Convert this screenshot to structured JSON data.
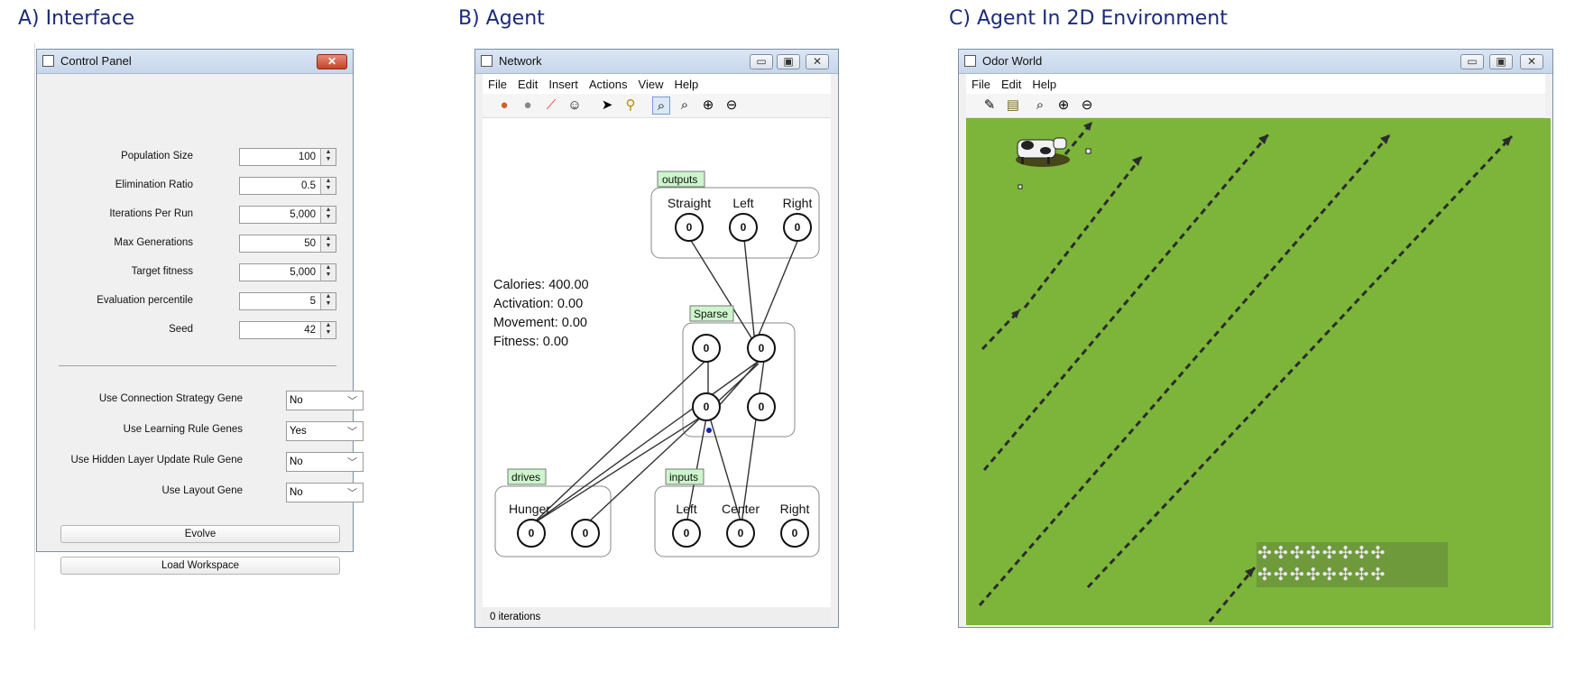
{
  "panels": {
    "a_title": "A) Interface",
    "b_title": "B) Agent",
    "c_title": "C) Agent In 2D Environment"
  },
  "control_panel": {
    "window_title": "Control Panel",
    "close_glyph": "✕",
    "fields": [
      {
        "label": "Population Size",
        "value": "100"
      },
      {
        "label": "Elimination Ratio",
        "value": "0.5"
      },
      {
        "label": "Iterations Per Run",
        "value": "5,000"
      },
      {
        "label": "Max Generations",
        "value": "50"
      },
      {
        "label": "Target fitness",
        "value": "5,000"
      },
      {
        "label": "Evaluation percentile",
        "value": "5"
      },
      {
        "label": "Seed",
        "value": "42"
      }
    ],
    "dropdowns": [
      {
        "label": "Use Connection Strategy Gene",
        "value": "No"
      },
      {
        "label": "Use Learning Rule Genes",
        "value": "Yes"
      },
      {
        "label": "Use Hidden Layer Update Rule Gene",
        "value": "No"
      },
      {
        "label": "Use Layout Gene",
        "value": "No"
      }
    ],
    "buttons": {
      "evolve": "Evolve",
      "load_workspace": "Load Workspace"
    }
  },
  "network": {
    "window_title": "Network",
    "menu": [
      "File",
      "Edit",
      "Insert",
      "Actions",
      "View",
      "Help"
    ],
    "toolbar_icons": [
      "neuron-icon",
      "gray-neuron-icon",
      "eraser-icon",
      "smiley-icon",
      "pointer-icon",
      "wand-icon",
      "zoom-fit-icon",
      "zoom-icon",
      "zoom-in-icon",
      "zoom-out-icon"
    ],
    "stats": [
      "Calories: 400.00",
      "Activation: 0.00",
      "Movement: 0.00",
      "Fitness: 0.00"
    ],
    "groups": {
      "outputs": {
        "label": "outputs",
        "neurons": [
          {
            "name": "Straight",
            "value": "0"
          },
          {
            "name": "Left",
            "value": "0"
          },
          {
            "name": "Right",
            "value": "0"
          }
        ]
      },
      "sparse": {
        "label": "Sparse",
        "neurons": [
          {
            "value": "0"
          },
          {
            "value": "0"
          },
          {
            "value": "0"
          },
          {
            "value": "0"
          }
        ]
      },
      "drives": {
        "label": "drives",
        "neurons": [
          {
            "name": "Hunger",
            "value": "0"
          },
          {
            "name": "",
            "value": "0"
          }
        ]
      },
      "inputs": {
        "label": "inputs",
        "neurons": [
          {
            "name": "Left",
            "value": "0"
          },
          {
            "name": "Center",
            "value": "0"
          },
          {
            "name": "Right",
            "value": "0"
          }
        ]
      }
    },
    "status": "0 iterations",
    "colors": {
      "group_label_bg": "#ccf5cc",
      "excitatory": "#d01010",
      "inhibitory": "#1020c0"
    }
  },
  "odor_world": {
    "window_title": "Odor World",
    "menu": [
      "File",
      "Edit",
      "Help"
    ],
    "toolbar_icons": [
      "pencil-icon",
      "image-icon",
      "zoom-fit-icon",
      "zoom-in-icon",
      "zoom-out-icon"
    ],
    "colors": {
      "grass": "#7cb53a",
      "arrow": "#2b2b2b"
    },
    "flower_glyph": "✣"
  }
}
